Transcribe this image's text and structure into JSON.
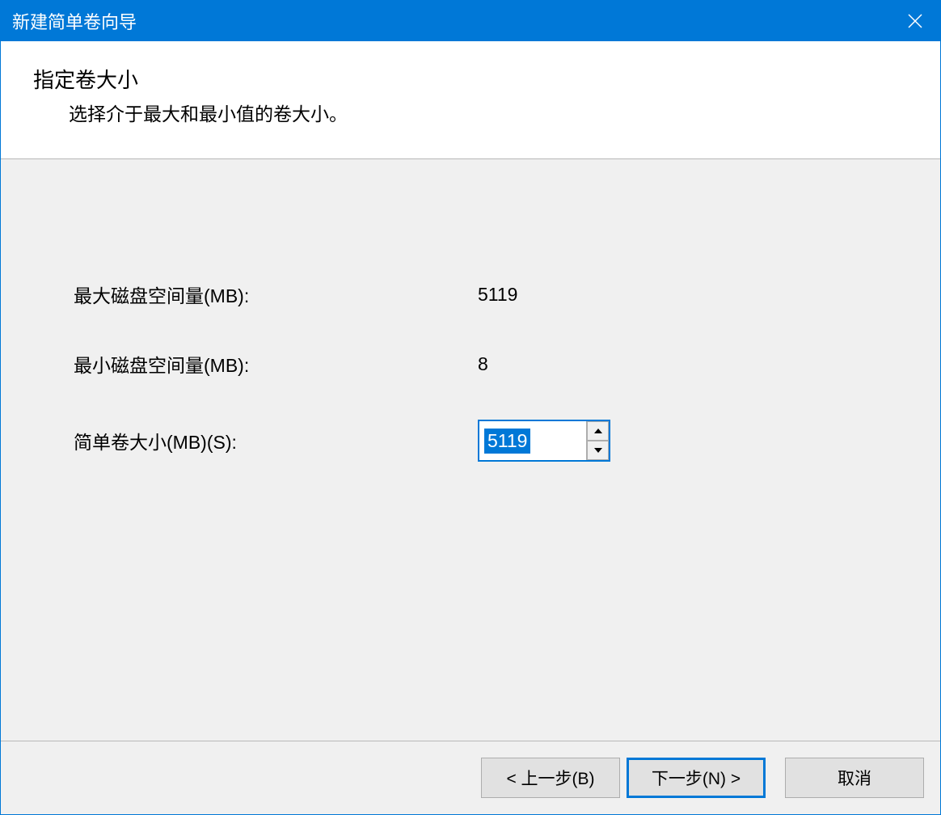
{
  "titlebar": {
    "title": "新建简单卷向导"
  },
  "header": {
    "title": "指定卷大小",
    "subtitle": "选择介于最大和最小值的卷大小。"
  },
  "form": {
    "max_space_label": "最大磁盘空间量(MB):",
    "max_space_value": "5119",
    "min_space_label": "最小磁盘空间量(MB):",
    "min_space_value": "8",
    "size_label": "简单卷大小(MB)(S):",
    "size_value": "5119"
  },
  "buttons": {
    "back": "< 上一步(B)",
    "next": "下一步(N) >",
    "cancel": "取消"
  }
}
